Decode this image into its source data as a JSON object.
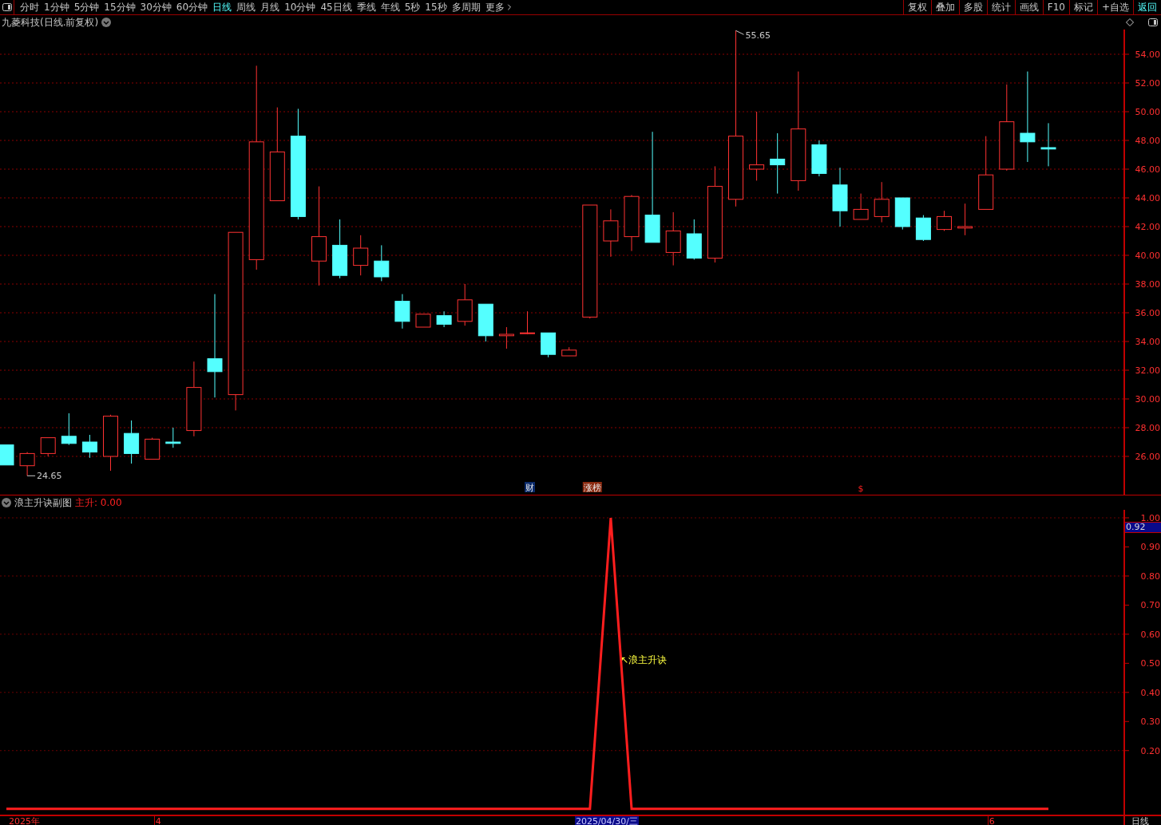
{
  "toolbar": {
    "tabs": [
      {
        "label": "分时",
        "selected": false
      },
      {
        "label": "1分钟",
        "selected": false
      },
      {
        "label": "5分钟",
        "selected": false
      },
      {
        "label": "15分钟",
        "selected": false
      },
      {
        "label": "30分钟",
        "selected": false
      },
      {
        "label": "60分钟",
        "selected": false
      },
      {
        "label": "日线",
        "selected": true
      },
      {
        "label": "周线",
        "selected": false
      },
      {
        "label": "月线",
        "selected": false
      },
      {
        "label": "10分钟",
        "selected": false
      },
      {
        "label": "45日线",
        "selected": false
      },
      {
        "label": "季线",
        "selected": false
      },
      {
        "label": "年线",
        "selected": false
      },
      {
        "label": "5秒",
        "selected": false
      },
      {
        "label": "15秒",
        "selected": false
      },
      {
        "label": "多周期",
        "selected": false
      },
      {
        "label": "更多",
        "selected": false
      }
    ],
    "buttons": [
      {
        "label": "复权",
        "kind": "tool"
      },
      {
        "label": "叠加",
        "kind": "tool"
      },
      {
        "label": "多股",
        "kind": "tool"
      },
      {
        "label": "统计",
        "kind": "tool"
      },
      {
        "label": "画线",
        "kind": "tool"
      },
      {
        "label": "F10",
        "kind": "tool"
      },
      {
        "label": "标记",
        "kind": "tool"
      },
      {
        "label": "+自选",
        "kind": "tool"
      },
      {
        "label": "返回",
        "kind": "back"
      }
    ]
  },
  "main_chart": {
    "title": "九菱科技(日线.前复权)",
    "price_labels": [
      "54.00",
      "52.00",
      "50.00",
      "48.00",
      "46.00",
      "44.00",
      "42.00",
      "40.00",
      "38.00",
      "36.00",
      "34.00",
      "32.00",
      "30.00",
      "28.00",
      "26.00"
    ],
    "high_label": "55.65",
    "low_label": "24.65",
    "markers": [
      {
        "label": "财",
        "kind": "finance"
      },
      {
        "label": "涨榜",
        "kind": "rank"
      },
      {
        "label": "$",
        "kind": "dollar"
      }
    ]
  },
  "sub_chart": {
    "title": "浪主升诀副图",
    "reading": ": 0.00",
    "readout": "0.92",
    "chart_data": {
      "type": "line",
      "grid": true,
      "ylim": [
        -0.02,
        1
      ],
      "yticks": [
        {
          "value": 0.2,
          "label": "0.20"
        },
        {
          "value": 0.3,
          "label": "0.30"
        },
        {
          "value": 0.4,
          "label": "0.40"
        },
        {
          "value": 0.5,
          "label": "0.50"
        },
        {
          "value": 0.6,
          "label": "0.60"
        },
        {
          "value": 0.7,
          "label": "0.70"
        },
        {
          "value": 0.8,
          "label": "0.80"
        },
        {
          "value": 0.9,
          "label": "0.90"
        },
        {
          "value": 1.0,
          "label": "1.00"
        }
      ],
      "series": [
        {
          "name": "主升",
          "color": "#ff1e1e",
          "values": [
            0,
            0,
            0,
            0,
            0,
            0,
            0,
            0,
            0,
            0,
            0,
            0,
            0,
            0,
            0,
            0,
            0,
            0,
            0,
            0,
            0,
            0,
            0,
            0,
            0,
            0,
            0,
            0,
            0,
            1,
            0,
            0,
            0,
            0,
            0,
            0,
            0,
            0,
            0,
            0,
            0,
            0,
            0,
            0,
            0,
            0,
            0,
            0,
            0,
            0,
            0
          ]
        }
      ],
      "annotations": [
        {
          "text": "↖浪主升诀"
        }
      ]
    }
  },
  "time_axis": {
    "labels": [
      "2025年",
      "4",
      "6"
    ],
    "cursor_date": "2025/04/30/三",
    "period": "日线"
  }
}
